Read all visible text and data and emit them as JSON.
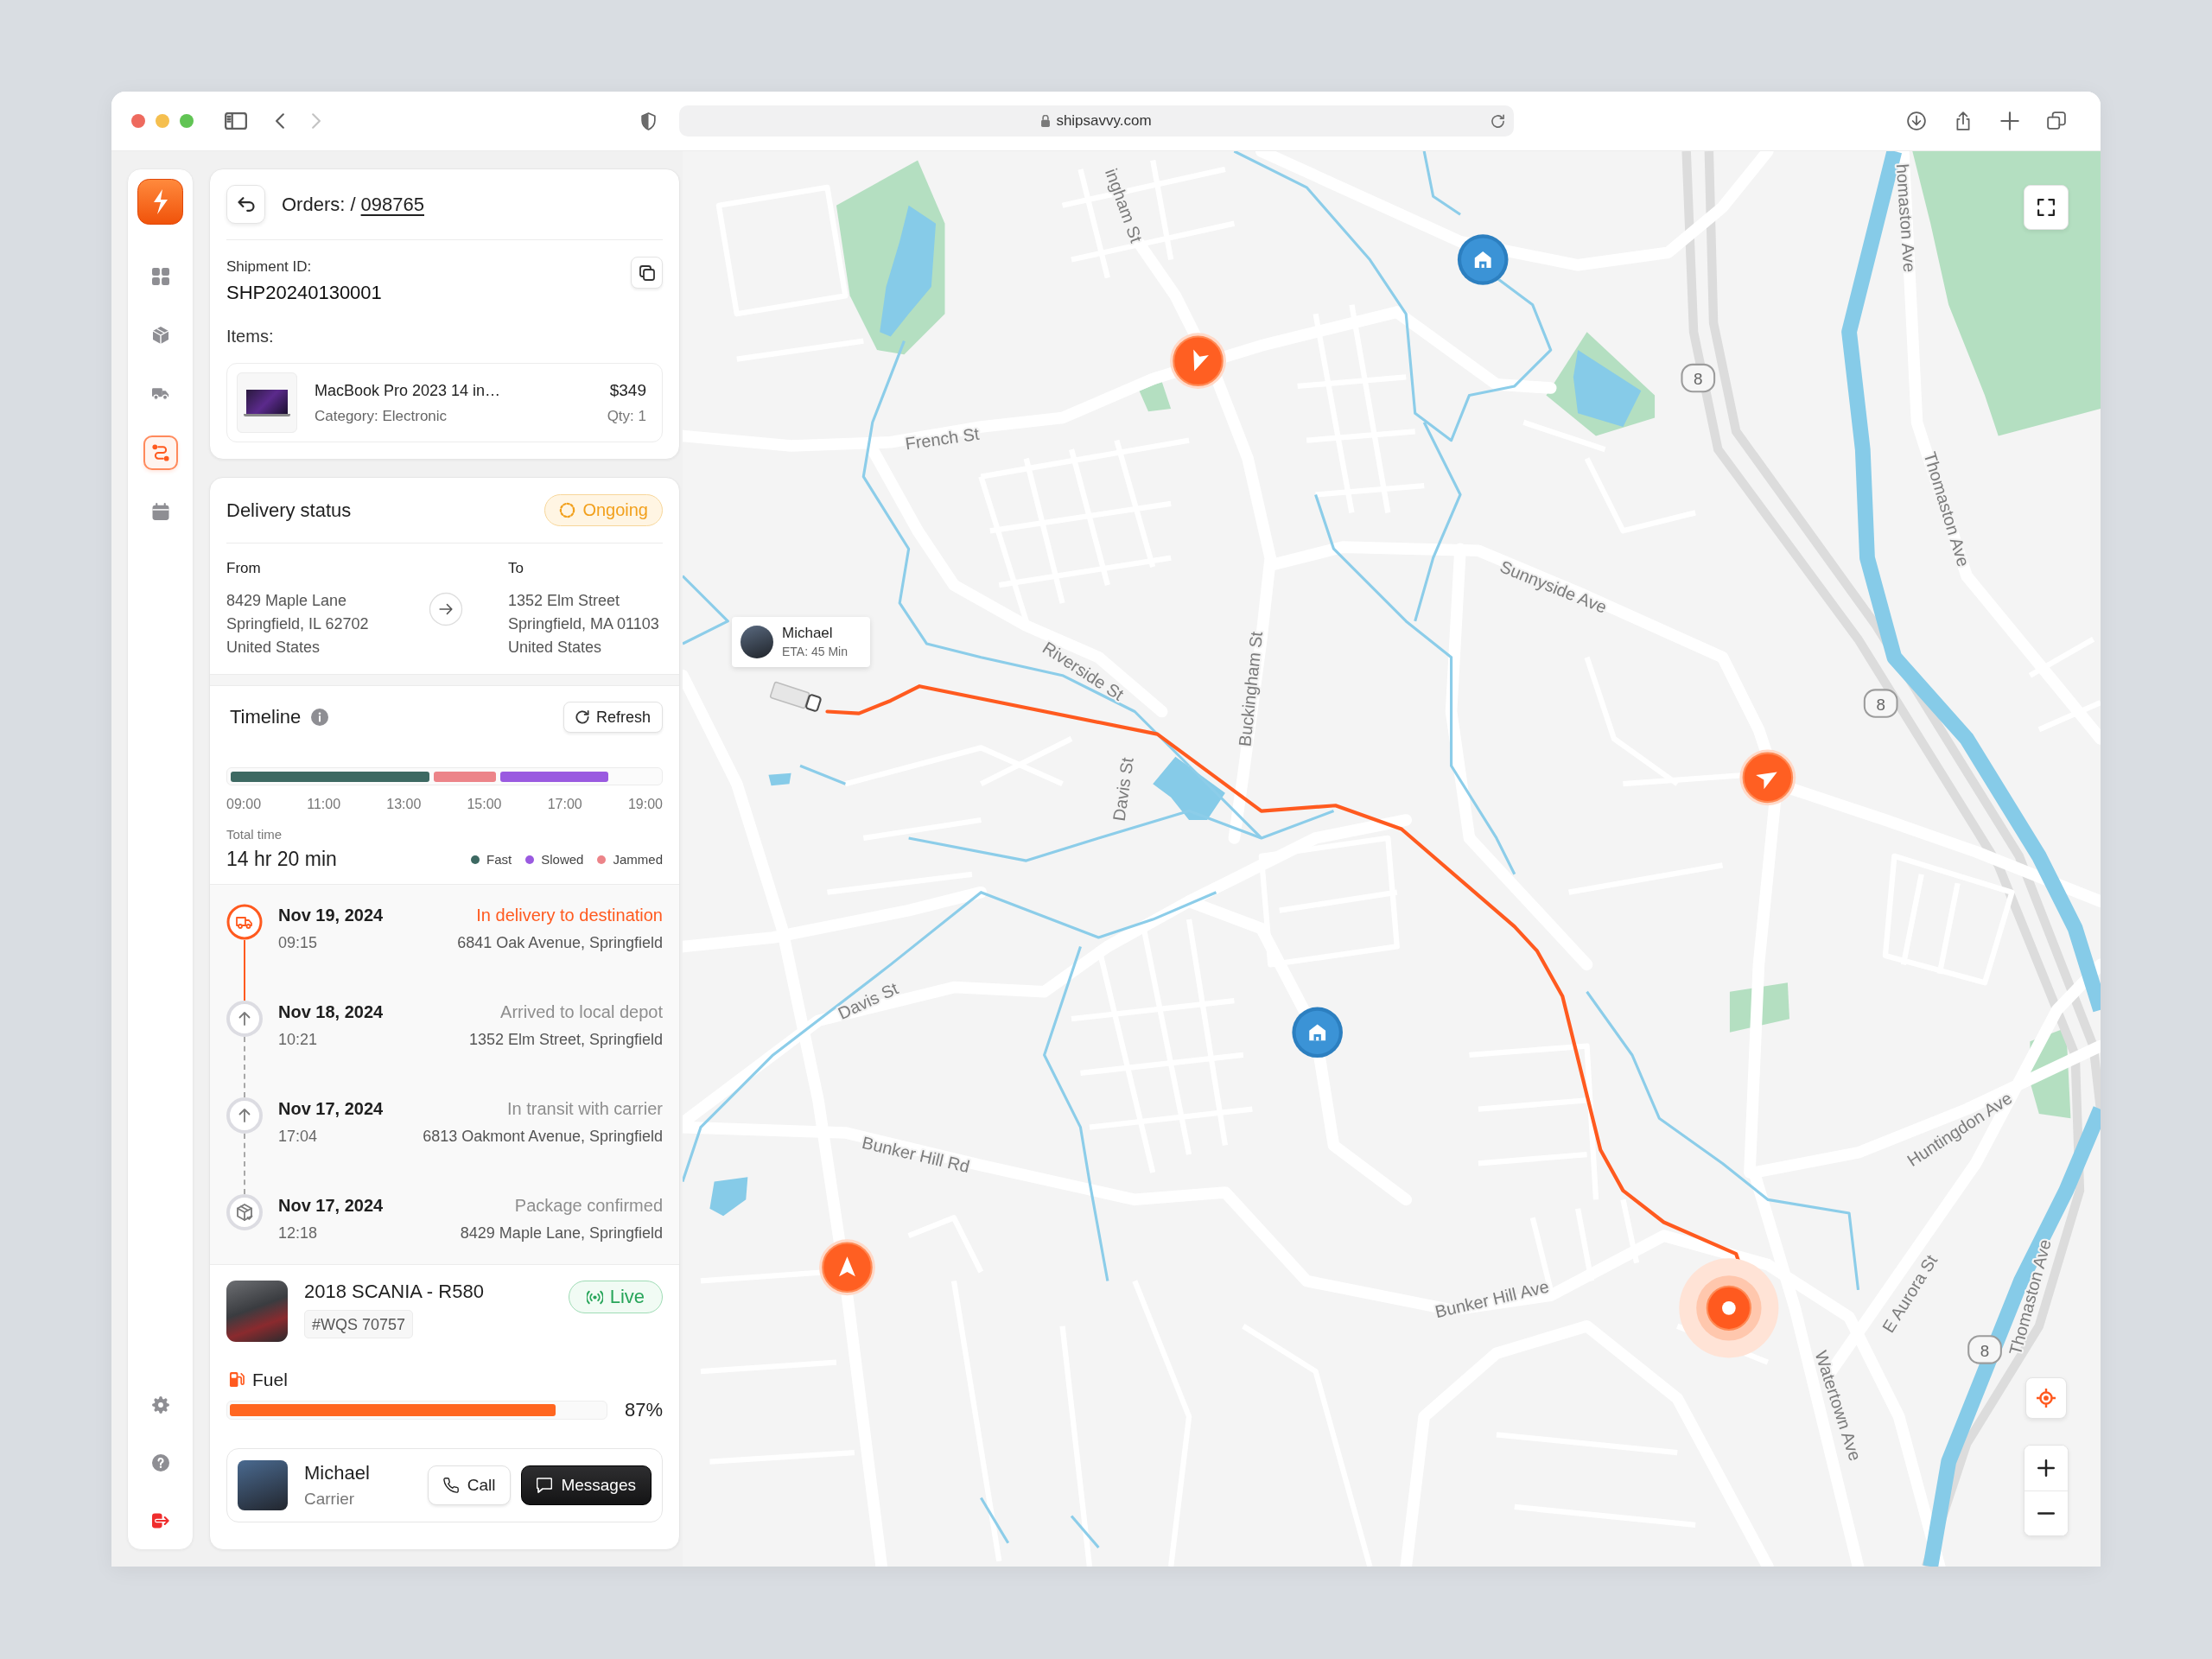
{
  "browser": {
    "url": "shipsavvy.com",
    "nav": [
      {
        "kind": "back",
        "disabled": false
      },
      {
        "kind": "forward",
        "disabled": true
      }
    ]
  },
  "sidebar": {
    "items": [
      {
        "kind": "dashboard",
        "selected": false
      },
      {
        "kind": "products",
        "selected": false
      },
      {
        "kind": "fleet",
        "selected": false
      },
      {
        "kind": "routes",
        "selected": true
      },
      {
        "kind": "schedule",
        "selected": false
      }
    ]
  },
  "order": {
    "breadcrumb": "Orders: /",
    "number": "098765",
    "shipment_label": "Shipment ID:",
    "shipment_id": "SHP20240130001",
    "items_label": "Items:",
    "items": [
      {
        "name": "MacBook Pro 2023 14 in…",
        "category": "Category: Electronic",
        "price": "$349",
        "qty": "Qty: 1"
      }
    ]
  },
  "delivery": {
    "title": "Delivery status",
    "status": {
      "kind": "ongoing",
      "label": "Ongoing"
    },
    "from": {
      "label": "From",
      "lines": [
        "8429 Maple Lane",
        "Springfield, IL 62702",
        "United States"
      ]
    },
    "to": {
      "label": "To",
      "lines": [
        "1352 Elm Street",
        "Springfield, MA 01103",
        "United States"
      ]
    }
  },
  "timeline": {
    "title": "Timeline",
    "refresh": "Refresh",
    "segments": [
      {
        "color": "#3d6962"
      },
      {
        "color": "#ec8489"
      },
      {
        "color": "#9a5ae0"
      }
    ],
    "ticks": [
      "09:00",
      "11:00",
      "13:00",
      "15:00",
      "17:00",
      "19:00"
    ],
    "total_label": "Total time",
    "total": "14 hr 20 min",
    "legend": [
      {
        "label": "Fast",
        "color": "#3d6962"
      },
      {
        "label": "Slowed",
        "color": "#9a5ae0"
      },
      {
        "label": "Jammed",
        "color": "#ec8489"
      }
    ]
  },
  "events": [
    {
      "kind": "delivery",
      "current": true,
      "date": "Nov 19, 2024",
      "time": "09:15",
      "status": "In delivery to destination",
      "address": "6841 Oak Avenue, Springfield"
    },
    {
      "kind": "transit",
      "current": false,
      "date": "Nov 18, 2024",
      "time": "10:21",
      "status": "Arrived to local depot",
      "address": "1352 Elm Street, Springfield"
    },
    {
      "kind": "transit",
      "current": false,
      "date": "Nov 17, 2024",
      "time": "17:04",
      "status": "In transit with carrier",
      "address": "6813 Oakmont Avenue, Springfield"
    },
    {
      "kind": "confirmed",
      "current": false,
      "date": "Nov 17, 2024",
      "time": "12:18",
      "status": "Package confirmed",
      "address": "8429 Maple Lane, Springfield"
    }
  ],
  "vehicle": {
    "name": "2018 SCANIA - R580",
    "plate": "#WQS 70757",
    "status": {
      "kind": "live",
      "label": "Live"
    },
    "fuel": {
      "label": "Fuel",
      "level": 0.87,
      "reading": "87%"
    }
  },
  "carrier": {
    "name": "Michael",
    "role": "Carrier",
    "buttons": [
      {
        "kind": "call",
        "label": "Call"
      },
      {
        "kind": "messages",
        "label": "Messages"
      }
    ]
  },
  "map": {
    "driver": {
      "name": "Michael",
      "eta": "ETA: 45 Min"
    },
    "street_labels": [
      "ingham St",
      "French St",
      "Riverside St",
      "Buckingham St",
      "Davis St",
      "Sunnyside Ave",
      "Davis St",
      "Bunker Hill Rd",
      "Bunker Hill Ave",
      "Watertown Ave",
      "E Aurora St",
      "Huntingdon Ave",
      "Thomaston Ave",
      "homaston Ave",
      "Thomaston Ave"
    ],
    "route_shields": [
      "8",
      "8",
      "8"
    ]
  }
}
